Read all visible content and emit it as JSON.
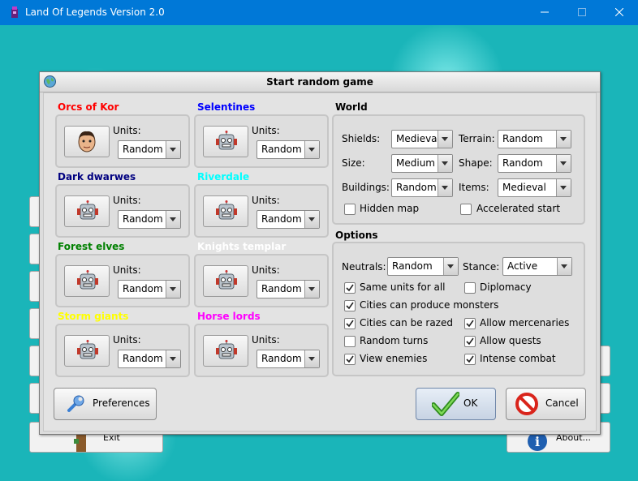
{
  "window": {
    "title": "Land Of Legends Version 2.0"
  },
  "main_menu": {
    "exit_label": "Exit",
    "about_label": "About..."
  },
  "dialog": {
    "title": "Start random game",
    "players": [
      {
        "name": "Orcs of Kor",
        "color": "#ff0000",
        "units_label": "Units:",
        "units_value": "Random",
        "avatar": "human-face-icon"
      },
      {
        "name": "Selentines",
        "color": "#0000ff",
        "units_label": "Units:",
        "units_value": "Random",
        "avatar": "robot-icon"
      },
      {
        "name": "Dark dwarwes",
        "color": "#000080",
        "units_label": "Units:",
        "units_value": "Random",
        "avatar": "robot-icon"
      },
      {
        "name": "Riverdale",
        "color": "#00ffff",
        "units_label": "Units:",
        "units_value": "Random",
        "avatar": "robot-icon"
      },
      {
        "name": "Forest elves",
        "color": "#008000",
        "units_label": "Units:",
        "units_value": "Random",
        "avatar": "robot-icon"
      },
      {
        "name": "Knights templar",
        "color": "#ffffff",
        "units_label": "Units:",
        "units_value": "Random",
        "avatar": "robot-icon"
      },
      {
        "name": "Storm giants",
        "color": "#ffff00",
        "units_label": "Units:",
        "units_value": "Random",
        "avatar": "robot-icon"
      },
      {
        "name": "Horse lords",
        "color": "#ff00ff",
        "units_label": "Units:",
        "units_value": "Random",
        "avatar": "robot-icon"
      }
    ],
    "world": {
      "title": "World",
      "shields_label": "Shields:",
      "shields_value": "Medieval",
      "terrain_label": "Terrain:",
      "terrain_value": "Random",
      "size_label": "Size:",
      "size_value": "Medium",
      "shape_label": "Shape:",
      "shape_value": "Random",
      "buildings_label": "Buildings:",
      "buildings_value": "Random",
      "items_label": "Items:",
      "items_value": "Medieval",
      "hidden_map": {
        "label": "Hidden map",
        "checked": false
      },
      "accelerated_start": {
        "label": "Accelerated start",
        "checked": false
      }
    },
    "options": {
      "title": "Options",
      "neutrals_label": "Neutrals:",
      "neutrals_value": "Random",
      "stance_label": "Stance:",
      "stance_value": "Active",
      "checkboxes": [
        {
          "label": "Same units for all",
          "checked": true
        },
        {
          "label": "Diplomacy",
          "checked": false
        },
        {
          "label": "Cities can produce monsters",
          "checked": true
        },
        {
          "label": "Cities can be razed",
          "checked": true
        },
        {
          "label": "Allow mercenaries",
          "checked": true
        },
        {
          "label": "Random turns",
          "checked": false
        },
        {
          "label": "Allow quests",
          "checked": true
        },
        {
          "label": "View enemies",
          "checked": true
        },
        {
          "label": "Intense combat",
          "checked": true
        }
      ]
    },
    "buttons": {
      "preferences": "Preferences",
      "ok": "OK",
      "cancel": "Cancel"
    }
  }
}
